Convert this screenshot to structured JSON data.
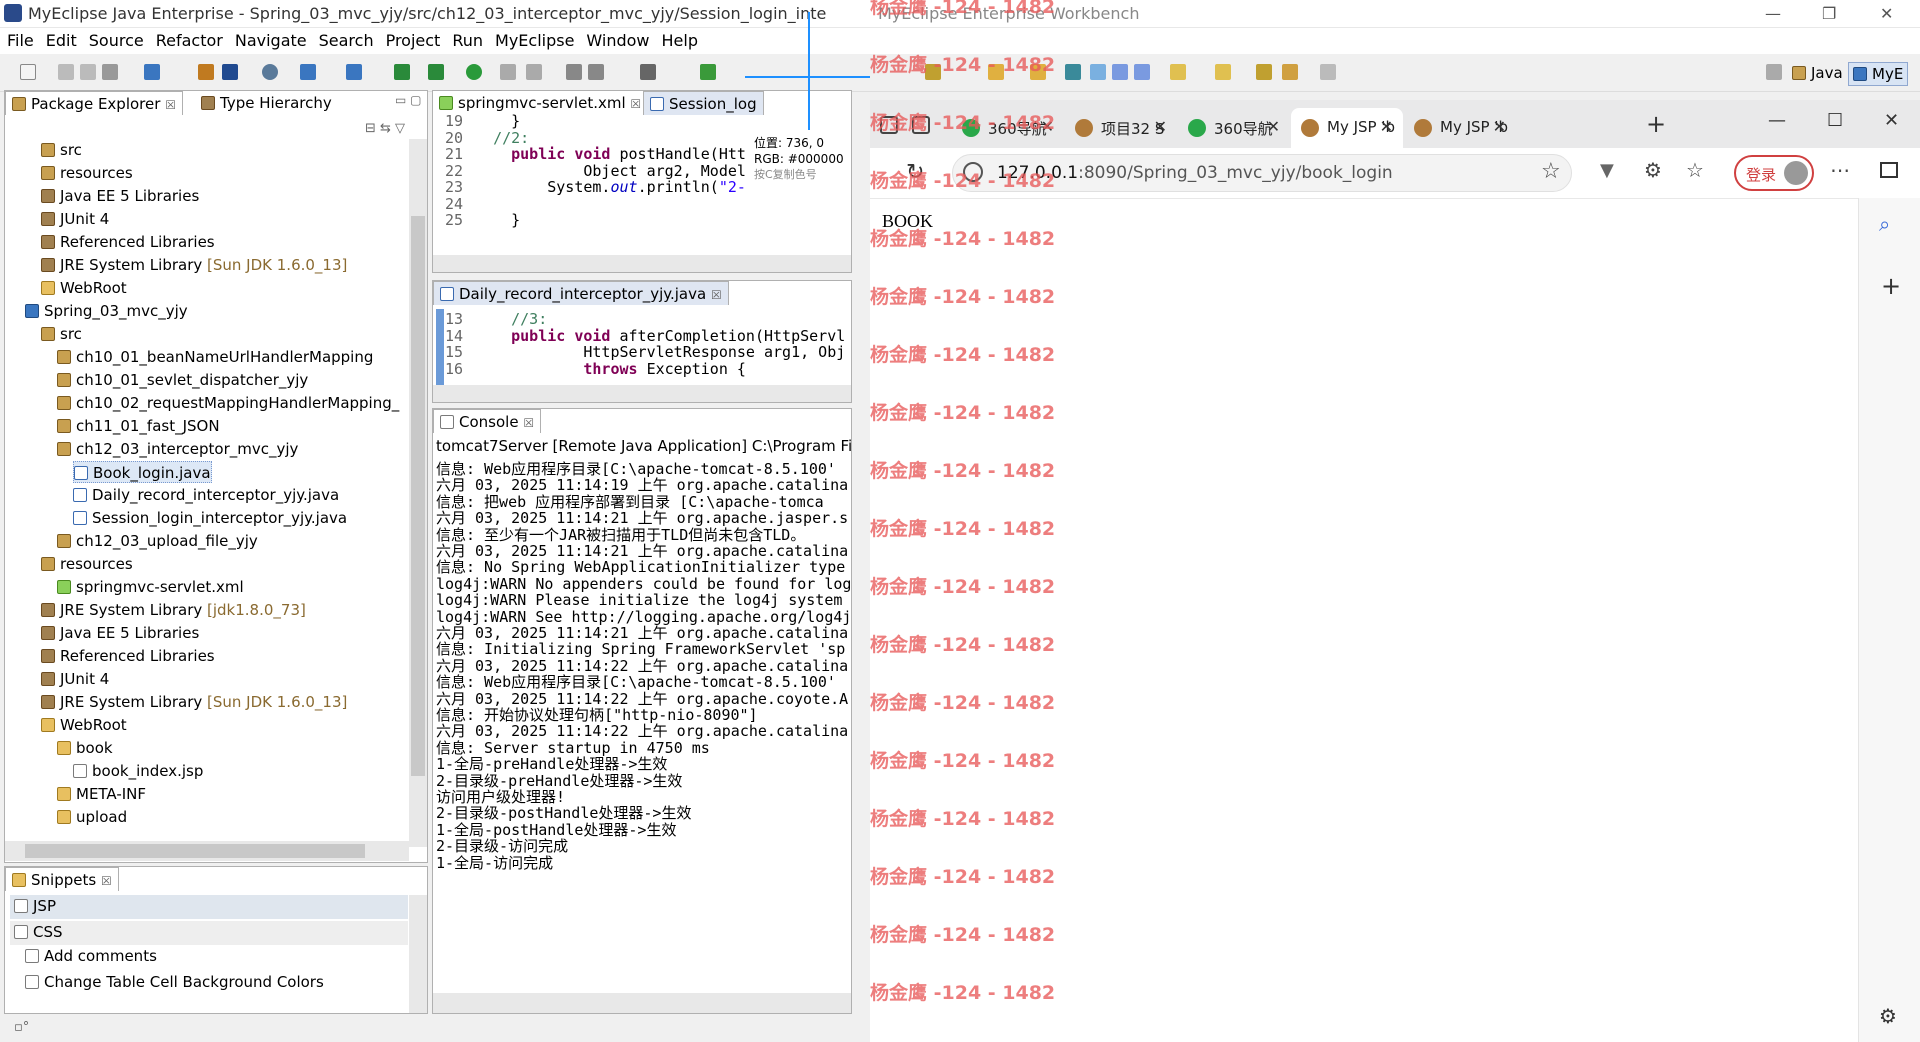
{
  "window": {
    "title": "MyEclipse Java Enterprise - Spring_03_mvc_yjy/src/ch12_03_interceptor_mvc_yjy/Session_login_inte",
    "title2": "MyEclipse Enterprise Workbench"
  },
  "menu": [
    "File",
    "Edit",
    "Source",
    "Refactor",
    "Navigate",
    "Search",
    "Project",
    "Run",
    "MyEclipse",
    "Window",
    "Help"
  ],
  "perspectives": {
    "java": "Java",
    "mye": "MyE"
  },
  "explorer": {
    "tabs": [
      "Package Explorer",
      "Type Hierarchy"
    ],
    "items": [
      {
        "label": "src",
        "icon": "pkg"
      },
      {
        "label": "resources",
        "icon": "pkg"
      },
      {
        "label": "Java EE 5 Libraries",
        "icon": "lib"
      },
      {
        "label": "JUnit 4",
        "icon": "lib"
      },
      {
        "label": "Referenced Libraries",
        "icon": "lib"
      },
      {
        "label": "JRE System Library",
        "icon": "lib",
        "suffix": "[Sun JDK 1.6.0_13]"
      },
      {
        "label": "WebRoot",
        "icon": "fld"
      },
      {
        "label": "Spring_03_mvc_yjy",
        "icon": "prj"
      },
      {
        "label": "src",
        "icon": "pkg"
      },
      {
        "label": "ch10_01_beanNameUrlHandlerMapping",
        "icon": "pkg"
      },
      {
        "label": "ch10_01_sevlet_dispatcher_yjy",
        "icon": "pkg"
      },
      {
        "label": "ch10_02_requestMappingHandlerMapping_",
        "icon": "pkg"
      },
      {
        "label": "ch11_01_fast_JSON",
        "icon": "pkg"
      },
      {
        "label": "ch12_03_interceptor_mvc_yjy",
        "icon": "pkg"
      },
      {
        "label": "Book_login.java",
        "icon": "jav"
      },
      {
        "label": "Daily_record_interceptor_yjy.java",
        "icon": "jav"
      },
      {
        "label": "Session_login_interceptor_yjy.java",
        "icon": "jav"
      },
      {
        "label": "ch12_03_upload_file_yjy",
        "icon": "pkg"
      },
      {
        "label": "resources",
        "icon": "pkg"
      },
      {
        "label": "springmvc-servlet.xml",
        "icon": "xml"
      },
      {
        "label": "JRE System Library",
        "icon": "lib",
        "suffix": "[jdk1.8.0_73]"
      },
      {
        "label": "Java EE 5 Libraries",
        "icon": "lib"
      },
      {
        "label": "Referenced Libraries",
        "icon": "lib"
      },
      {
        "label": "JUnit 4",
        "icon": "lib"
      },
      {
        "label": "JRE System Library",
        "icon": "lib",
        "suffix": "[Sun JDK 1.6.0_13]"
      },
      {
        "label": "WebRoot",
        "icon": "fld"
      },
      {
        "label": "book",
        "icon": "fld"
      },
      {
        "label": "book_index.jsp",
        "icon": "jsp"
      },
      {
        "label": "META-INF",
        "icon": "fld"
      },
      {
        "label": "upload",
        "icon": "fld"
      }
    ]
  },
  "snippets": {
    "tab": "Snippets",
    "items": [
      "JSP",
      "CSS",
      "Add comments",
      "Change Table Cell Background Colors"
    ]
  },
  "editor1": {
    "tabs": [
      "springmvc-servlet.xml",
      "Session_log"
    ],
    "lines": [
      {
        "n": "19",
        "t": "    }"
      },
      {
        "n": "20",
        "t": "  //2:"
      },
      {
        "n": "21",
        "t": "    public void postHandle(Htt"
      },
      {
        "n": "22",
        "t": "            Object arg2, Model"
      },
      {
        "n": "23",
        "t": "        System.out.println(\"2-"
      },
      {
        "n": "24",
        "t": ""
      },
      {
        "n": "25",
        "t": "    }"
      }
    ]
  },
  "colorpicker": {
    "pos": "位置: 736, 0",
    "rgb": "RGB: #000000",
    "hint": "按C复制色号"
  },
  "editor2": {
    "tab": "Daily_record_interceptor_yjy.java",
    "lines": [
      {
        "n": "13",
        "t": "    //3:"
      },
      {
        "n": "14",
        "t": "    public void afterCompletion(HttpServl"
      },
      {
        "n": "15",
        "t": "            HttpServletResponse arg1, Obj"
      },
      {
        "n": "16",
        "t": "            throws Exception {"
      }
    ]
  },
  "console": {
    "tab": "Console",
    "header": "tomcat7Server [Remote Java Application] C:\\Program File",
    "lines": [
      "信息: Web应用程序目录[C:\\apache-tomcat-8.5.100'",
      "六月 03, 2025 11:14:19 上午 org.apache.catalina",
      "信息: 把web 应用程序部署到目录 [C:\\apache-tomca",
      "六月 03, 2025 11:14:21 上午 org.apache.jasper.s",
      "信息: 至少有一个JAR被扫描用于TLD但尚未包含TLD。",
      "六月 03, 2025 11:14:21 上午 org.apache.catalina",
      "信息: No Spring WebApplicationInitializer type",
      "log4j:WARN No appenders could be found for log",
      "log4j:WARN Please initialize the log4j system",
      "log4j:WARN See http://logging.apache.org/log4j",
      "六月 03, 2025 11:14:21 上午 org.apache.catalina",
      "信息: Initializing Spring FrameworkServlet 'sp",
      "六月 03, 2025 11:14:22 上午 org.apache.catalina",
      "信息: Web应用程序目录[C:\\apache-tomcat-8.5.100'",
      "六月 03, 2025 11:14:22 上午 org.apache.coyote.A",
      "信息: 开始协议处理句柄[\"http-nio-8090\"]",
      "六月 03, 2025 11:14:22 上午 org.apache.catalina",
      "信息: Server startup in 4750 ms",
      "1-全局-preHandle处理器->生效",
      "2-目录级-preHandle处理器->生效",
      "访问用户级处理器!",
      "2-目录级-postHandle处理器->生效",
      "1-全局-postHandle处理器->生效",
      "2-目录级-访问完成",
      "1-全局-访问完成"
    ]
  },
  "browser": {
    "tabs": [
      {
        "label": "360导航",
        "color": "#2aa84a"
      },
      {
        "label": "项目32 S",
        "color": "#b07a3a"
      },
      {
        "label": "360导航",
        "color": "#2aa84a"
      },
      {
        "label": "My JSP 'b",
        "color": "#b07a3a"
      },
      {
        "label": "My JSP 'b",
        "color": "#b07a3a"
      }
    ],
    "url_host": "127.0.0.1",
    "url_rest": ":8090/Spring_03_mvc_yjy/book_login",
    "login_label": "登录",
    "page_text": "BOOK"
  },
  "watermark": "杨金鹰 -124 - 1482",
  "colors": {
    "accent": "#3a76c0",
    "watermark": "#e85a5a",
    "keyword": "#7f0055"
  }
}
